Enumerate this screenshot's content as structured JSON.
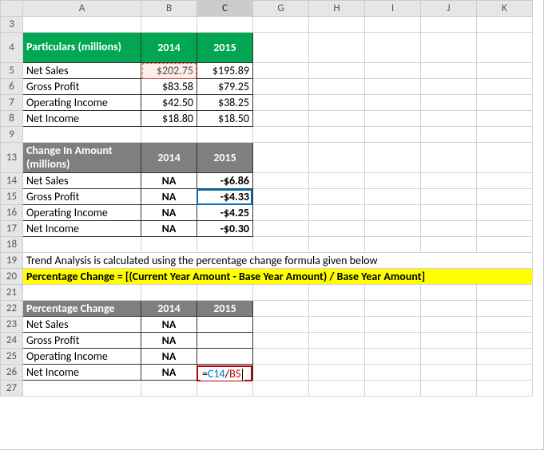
{
  "columns": [
    "A",
    "B",
    "C",
    "G",
    "H",
    "I",
    "J",
    "K"
  ],
  "activeColumn": "C",
  "table1": {
    "headers": {
      "particulars": "Particulars (millions)",
      "y1": "2014",
      "y2": "2015"
    },
    "rows": [
      {
        "label": "Net Sales",
        "y1": "$202.75",
        "y2": "$195.89"
      },
      {
        "label": "Gross Profit",
        "y1": "$83.58",
        "y2": "$79.25"
      },
      {
        "label": "Operating Income",
        "y1": "$42.50",
        "y2": "$38.25"
      },
      {
        "label": "Net Income",
        "y1": "$18.80",
        "y2": "$18.50"
      }
    ]
  },
  "table2": {
    "headers": {
      "change": "Change In Amount (millions)",
      "y1": "2014",
      "y2": "2015"
    },
    "rows": [
      {
        "label": "Net Sales",
        "y1": "NA",
        "y2": "-$6.86"
      },
      {
        "label": "Gross Profit",
        "y1": "NA",
        "y2": "-$4.33"
      },
      {
        "label": "Operating Income",
        "y1": "NA",
        "y2": "-$4.25"
      },
      {
        "label": "Net Income",
        "y1": "NA",
        "y2": "-$0.30"
      }
    ]
  },
  "note": {
    "line1": "Trend Analysis is calculated using the percentage change formula given below",
    "line2": "Percentage Change = [(Current Year Amount - Base Year Amount) / Base Year Amount]"
  },
  "table3": {
    "headers": {
      "pct": "Percentage Change",
      "y1": "2014",
      "y2": "2015"
    },
    "rows": [
      {
        "label": "Net Sales",
        "y1": "NA",
        "y2": ""
      },
      {
        "label": "Gross Profit",
        "y1": "NA",
        "y2": ""
      },
      {
        "label": "Operating Income",
        "y1": "NA",
        "y2": ""
      },
      {
        "label": "Net Income",
        "y1": "NA",
        "y2": ""
      }
    ]
  },
  "formula": {
    "eq": "=",
    "ref1": "C14",
    "slash": "/",
    "ref2": "B5"
  },
  "rowNumbers": [
    "3",
    "4",
    "5",
    "6",
    "7",
    "8",
    "9",
    "13",
    "14",
    "15",
    "16",
    "17",
    "18",
    "19",
    "20",
    "21",
    "22",
    "23",
    "24",
    "25",
    "26",
    "27"
  ],
  "chart_data": [
    {
      "type": "table",
      "title": "Particulars (millions)",
      "categories": [
        "2014",
        "2015"
      ],
      "series": [
        {
          "name": "Net Sales",
          "values": [
            202.75,
            195.89
          ]
        },
        {
          "name": "Gross Profit",
          "values": [
            83.58,
            79.25
          ]
        },
        {
          "name": "Operating Income",
          "values": [
            42.5,
            38.25
          ]
        },
        {
          "name": "Net Income",
          "values": [
            18.8,
            18.5
          ]
        }
      ]
    },
    {
      "type": "table",
      "title": "Change In Amount (millions)",
      "categories": [
        "2014",
        "2015"
      ],
      "series": [
        {
          "name": "Net Sales",
          "values": [
            null,
            -6.86
          ]
        },
        {
          "name": "Gross Profit",
          "values": [
            null,
            -4.33
          ]
        },
        {
          "name": "Operating Income",
          "values": [
            null,
            -4.25
          ]
        },
        {
          "name": "Net Income",
          "values": [
            null,
            -0.3
          ]
        }
      ]
    }
  ]
}
